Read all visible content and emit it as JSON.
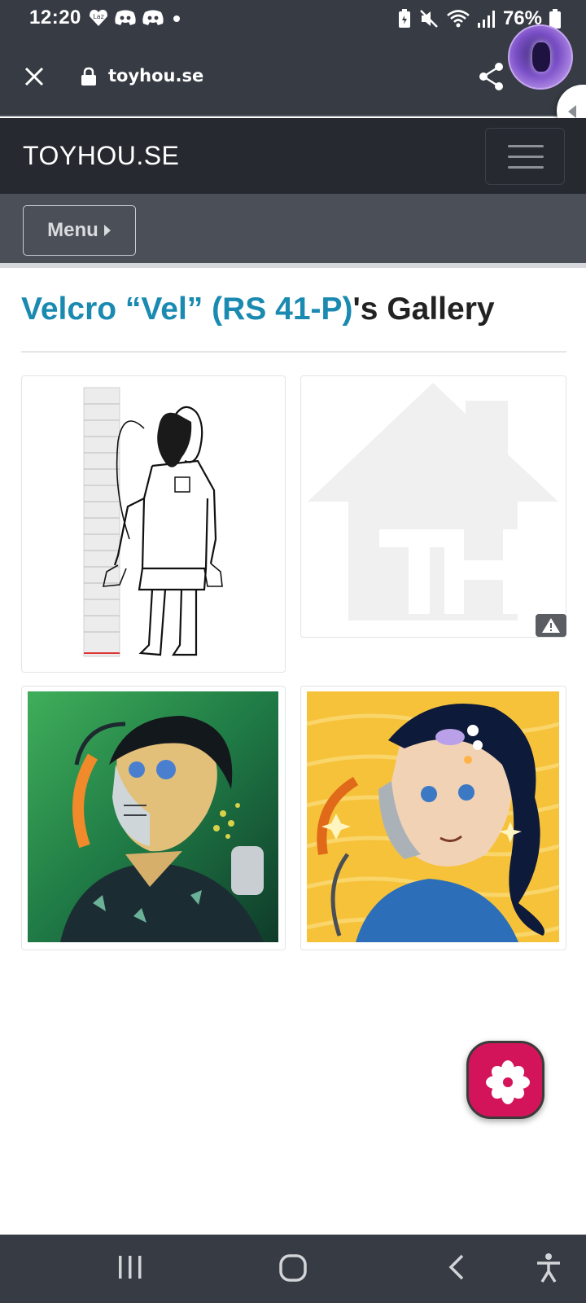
{
  "status_bar": {
    "time": "12:20",
    "battery": "76%",
    "notification_icons": [
      "lazada-icon",
      "discord-icon",
      "discord-icon",
      "dot-icon"
    ],
    "system_icons": [
      "battery-saver-icon",
      "mute-icon",
      "wifi-icon",
      "signal-icon",
      "battery-icon"
    ]
  },
  "browser": {
    "url": "toyhou.se",
    "close_icon": "close-icon",
    "lock_icon": "lock-icon",
    "share_icon": "share-icon"
  },
  "site": {
    "brand": "TOYHOU.SE",
    "menu_label": "Menu",
    "colors": {
      "link": "#1a8ab1",
      "navbar": "#262a30",
      "subnav": "#4b5058",
      "fab": "#d4145a"
    }
  },
  "gallery": {
    "character_link": "Velcro “Vel” (RS 41-P)",
    "title_suffix": "'s Gallery",
    "thumbnails": [
      {
        "kind": "height-chart-sketch"
      },
      {
        "kind": "placeholder-logo",
        "warning": true
      },
      {
        "kind": "green-portrait"
      },
      {
        "kind": "yellow-portrait"
      }
    ]
  },
  "android_nav": {
    "buttons": [
      "recents-icon",
      "home-icon",
      "back-icon",
      "accessibility-icon"
    ]
  }
}
